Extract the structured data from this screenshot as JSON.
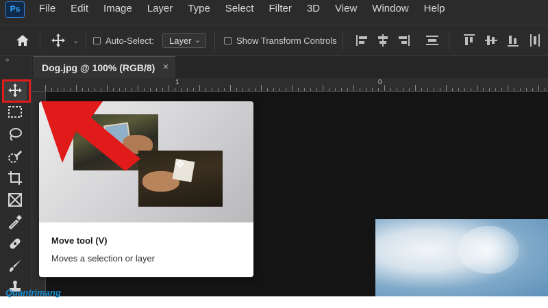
{
  "app": {
    "logo_text": "Ps",
    "menu": [
      "File",
      "Edit",
      "Image",
      "Layer",
      "Type",
      "Select",
      "Filter",
      "3D",
      "View",
      "Window",
      "Help"
    ]
  },
  "options_bar": {
    "auto_select_label": "Auto-Select:",
    "auto_select_checked": false,
    "layer_dropdown_value": "Layer",
    "show_transform_label": "Show Transform Controls",
    "show_transform_checked": false
  },
  "toolbar": {
    "tools": [
      "move-tool",
      "marquee-tool",
      "lasso-tool",
      "quick-selection-tool",
      "crop-tool",
      "frame-tool",
      "eyedropper-tool",
      "healing-brush-tool",
      "brush-tool",
      "clone-stamp-tool"
    ],
    "active_tool": "move-tool"
  },
  "document_tab": {
    "title": "Dog.jpg @ 100% (RGB/8)",
    "close_glyph": "×"
  },
  "ruler": {
    "labels": [
      "1",
      "0"
    ]
  },
  "tooltip": {
    "title": "Move tool (V)",
    "description": "Moves a selection or layer"
  },
  "watermark": {
    "text": "Quantrimang"
  },
  "colors": {
    "highlight": "#e21b1b",
    "arrow": "#e11a1a",
    "ui_bg": "#2b2b2b",
    "canvas_bg": "#141414"
  }
}
